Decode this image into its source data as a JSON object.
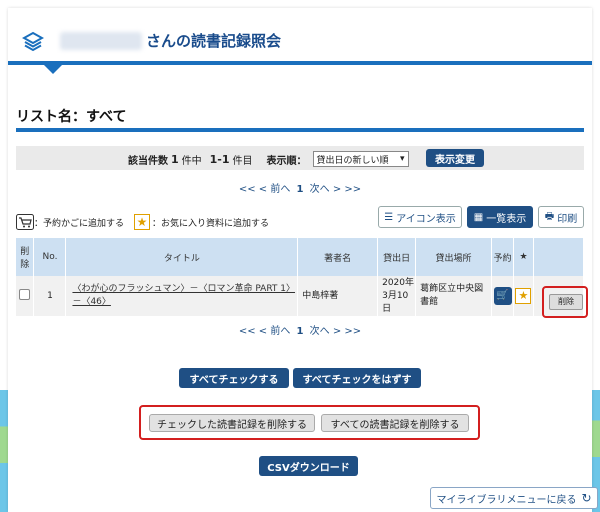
{
  "header": {
    "title": "さんの読書記録照会"
  },
  "list": {
    "name": "リスト名：すべて"
  },
  "info": {
    "count_label": "該当件数",
    "count_total": "1",
    "count_unit_mid": "件中",
    "range": "1-1",
    "count_unit": "件目",
    "sort_label": "表示順：",
    "sort_value": "貸出日の新しい順",
    "change_button": "表示変更"
  },
  "pager": {
    "first": "<<",
    "prev": "< 前へ",
    "current": "1",
    "next": "次へ >",
    "last": ">>"
  },
  "legend": {
    "cart_text": "：予約かごに追加する",
    "star_text": "：お気に入り資料に追加する"
  },
  "view_buttons": {
    "icon_view": "アイコン表示",
    "list_view": "一覧表示",
    "print": "印刷"
  },
  "table": {
    "headers": [
      "削除",
      "No.",
      "タイトル",
      "著者名",
      "貸出日",
      "貸出場所",
      "予約",
      "★"
    ],
    "rows": [
      {
        "no": "1",
        "title": "〈わが心のフラッシュマン〉－〈ロマン革命 PART 1〉－〈46〉",
        "author": "中島梓著",
        "date": "2020年3月10日",
        "place": "葛飾区立中央図書館",
        "delete_button": "削除"
      }
    ]
  },
  "buttons": {
    "check_all": "すべてチェックする",
    "uncheck_all": "すべてチェックをはずす",
    "delete_checked": "チェックした読書記録を削除する",
    "delete_all": "すべての読書記録を削除する",
    "csv": "CSVダウンロード",
    "back": "マイライブラリメニューに戻る"
  }
}
